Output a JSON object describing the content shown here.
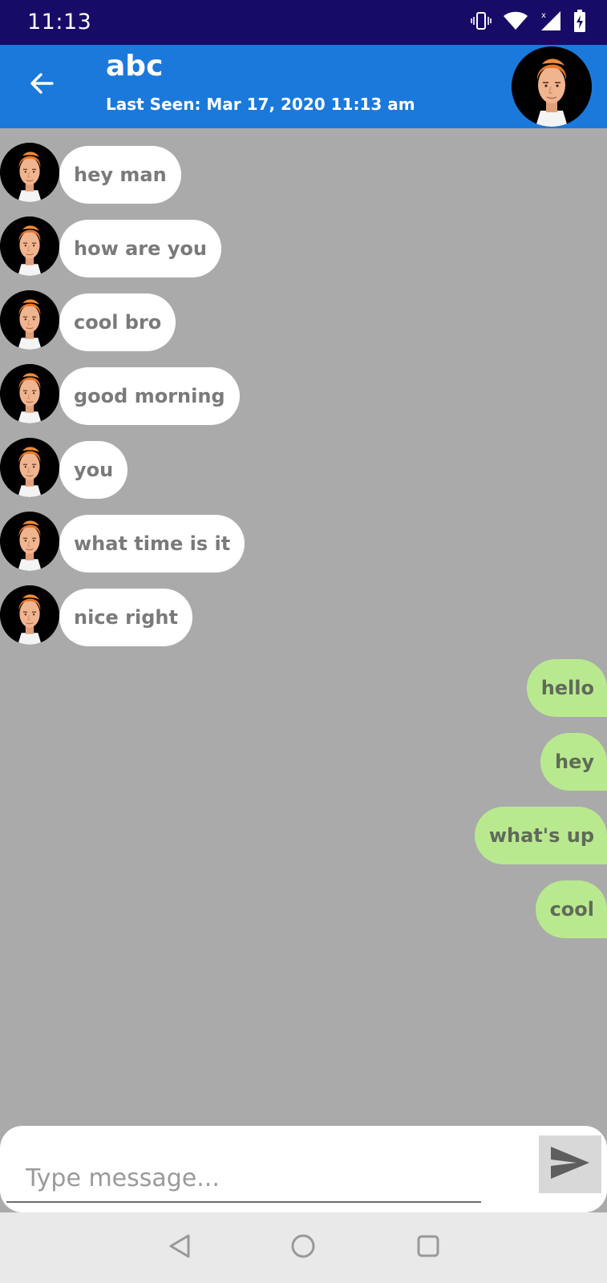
{
  "status_bar": {
    "time": "11:13",
    "icons": [
      "vibrate-icon",
      "wifi-icon",
      "signal-icon",
      "battery-charging-icon"
    ]
  },
  "header": {
    "title": "abc",
    "subtitle": "Last Seen: Mar 17, 2020 11:13 am",
    "back_icon": "arrow-back-icon",
    "avatar_icon": "avatar-icon"
  },
  "messages": {
    "incoming": [
      "hey man",
      "how are you",
      "cool bro",
      "good morning",
      "you",
      "what time is it",
      "nice right"
    ],
    "outgoing": [
      "hello",
      "hey",
      "what's up",
      "cool"
    ]
  },
  "composer": {
    "placeholder": "Type message...",
    "send_icon": "send-icon"
  },
  "nav_bar": {
    "icons": [
      "nav-back-icon",
      "nav-home-icon",
      "nav-recents-icon"
    ]
  },
  "colors": {
    "status_bar": "#170b68",
    "app_bar": "#1b79db",
    "chat_background": "#aaaaaa",
    "incoming_bubble": "#ffffff",
    "outgoing_bubble": "#b9e98f"
  }
}
